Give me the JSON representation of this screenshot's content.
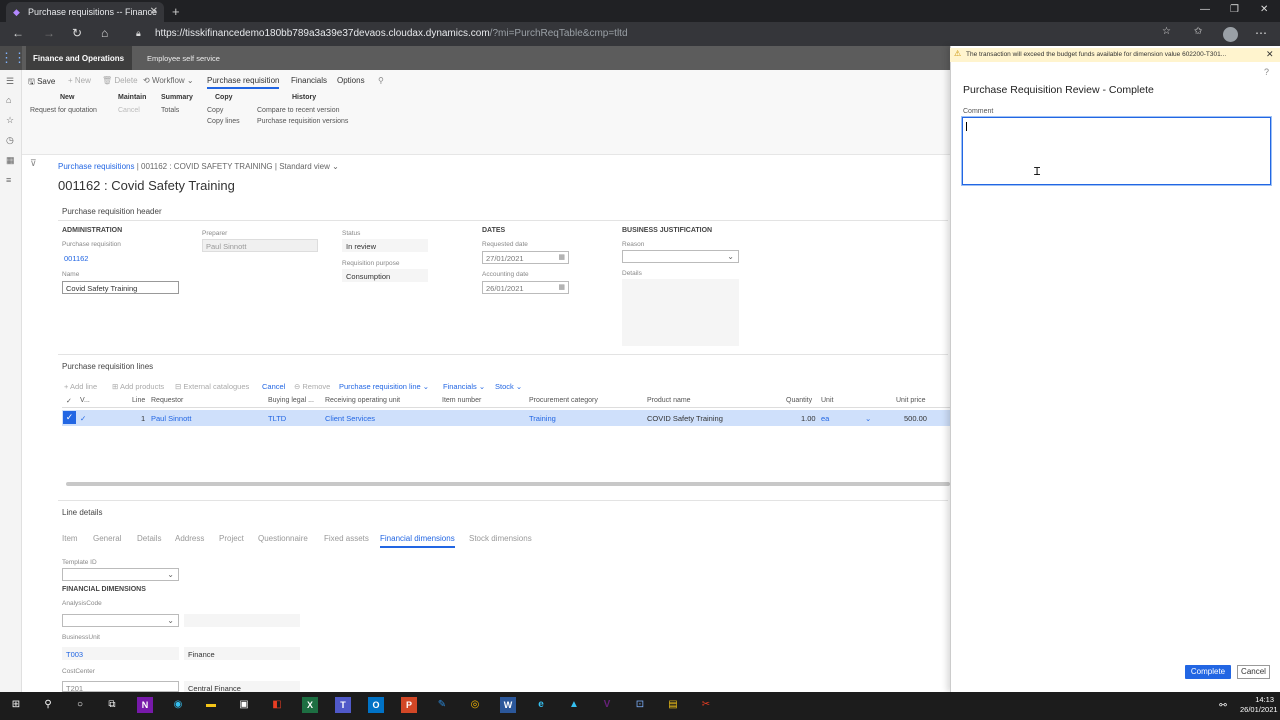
{
  "browser": {
    "tab_title": "Purchase requisitions -- Finance",
    "url_main": "https://tisskifinancedemo180bb789a3a39e37devaos.cloudax.dynamics.com",
    "url_rest": "/?mi=PurchReqTable&cmp=tltd"
  },
  "topnav": {
    "app_name": "Finance and Operations",
    "ess": "Employee self service"
  },
  "actionpane": {
    "buttons": [
      "Save",
      "+ New",
      "Delete",
      "Workflow",
      "Purchase requisition",
      "Financials",
      "Options"
    ],
    "groups": {
      "new": {
        "title": "New",
        "items": [
          "Request for quotation"
        ]
      },
      "maintain": {
        "title": "Maintain",
        "items": [
          "Cancel"
        ]
      },
      "summary": {
        "title": "Summary",
        "items": [
          "Totals"
        ]
      },
      "copy": {
        "title": "Copy",
        "items": [
          "Copy",
          "Copy lines"
        ]
      },
      "history": {
        "title": "History",
        "items": [
          "Compare to recent version",
          "Purchase requisition versions"
        ]
      }
    }
  },
  "breadcrumb": {
    "root": "Purchase requisitions",
    "sep": "|",
    "current": "001162 : COVID SAFETY TRAINING",
    "view": "Standard view"
  },
  "page_title": "001162 : Covid Safety Training",
  "header": {
    "section_title": "Purchase requisition header",
    "administration": {
      "title": "ADMINISTRATION",
      "pr_label": "Purchase requisition",
      "pr_value": "001162",
      "name_label": "Name",
      "name_value": "Covid Safety Training",
      "preparer_label": "Preparer",
      "preparer_value": "Paul Sinnott"
    },
    "status": {
      "status_label": "Status",
      "status_value": "In review",
      "purpose_label": "Requisition purpose",
      "purpose_value": "Consumption"
    },
    "dates": {
      "title": "DATES",
      "requested_label": "Requested date",
      "requested_value": "27/01/2021",
      "accounting_label": "Accounting date",
      "accounting_value": "26/01/2021"
    },
    "justification": {
      "title": "BUSINESS JUSTIFICATION",
      "reason_label": "Reason",
      "details_label": "Details"
    }
  },
  "lines": {
    "section_title": "Purchase requisition lines",
    "toolbar": [
      "+ Add line",
      "Add products",
      "External catalogues",
      "Cancel",
      "Remove",
      "Purchase requisition line",
      "Financials",
      "Stock"
    ],
    "columns": [
      "V...",
      "Line",
      "Requestor",
      "Buying legal ...",
      "Receiving operating unit",
      "Item number",
      "Procurement category",
      "Product name",
      "Quantity",
      "Unit",
      "Unit price"
    ],
    "row": {
      "line": "1",
      "requestor": "Paul Sinnott",
      "legal": "TLTD",
      "unit_op": "Client Services",
      "item": "",
      "category": "Training",
      "product": "COVID Safety Training",
      "qty": "1.00",
      "unit": "ea",
      "price": "500.00"
    }
  },
  "line_details": {
    "section_title": "Line details",
    "tabs": [
      "Item",
      "General",
      "Details",
      "Address",
      "Project",
      "Questionnaire",
      "Fixed assets",
      "Financial dimensions",
      "Stock dimensions"
    ],
    "template_label": "Template ID",
    "fin_dims_title": "FINANCIAL DIMENSIONS",
    "analysis_label": "AnalysisCode",
    "bu_label": "BusinessUnit",
    "bu_value": "T003",
    "bu_desc": "Finance",
    "cc_label": "CostCenter",
    "cc_value": "T201",
    "cc_desc": "Central Finance"
  },
  "flyout": {
    "warning": "The transaction will exceed the budget funds available for dimension value 602200-T301...",
    "title": "Purchase Requisition Review - Complete",
    "comment_label": "Comment",
    "comment_value": "",
    "complete_label": "Complete",
    "cancel_label": "Cancel"
  },
  "taskbar": {
    "time": "14:13",
    "date": "26/01/2021"
  },
  "colors": {
    "accent": "#2266e3",
    "nav": "#5c5c5c",
    "selected_row": "#cfe0fb"
  }
}
